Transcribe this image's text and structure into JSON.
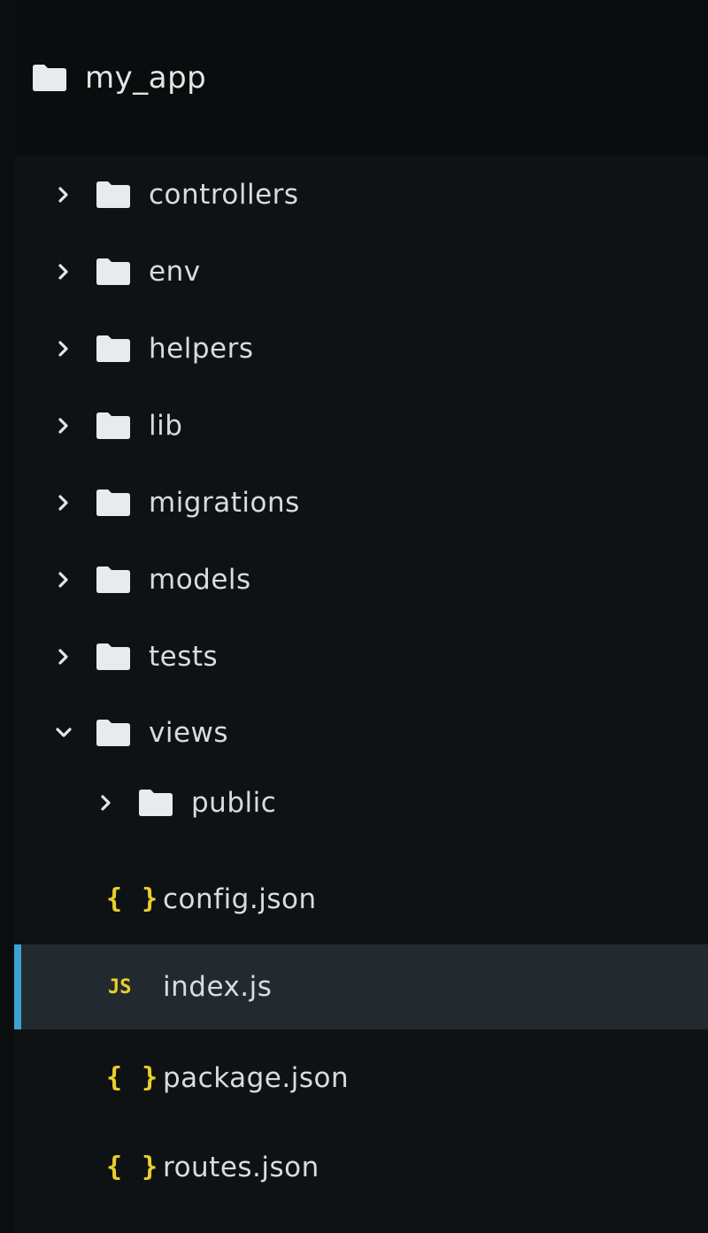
{
  "root": {
    "name": "my_app",
    "icon": "folder-icon"
  },
  "folders": [
    {
      "name": "controllers",
      "expanded": false,
      "icon": "folder-icon"
    },
    {
      "name": "env",
      "expanded": false,
      "icon": "folder-icon"
    },
    {
      "name": "helpers",
      "expanded": false,
      "icon": "folder-icon"
    },
    {
      "name": "lib",
      "expanded": false,
      "icon": "folder-icon"
    },
    {
      "name": "migrations",
      "expanded": false,
      "icon": "folder-icon"
    },
    {
      "name": "models",
      "expanded": false,
      "icon": "folder-icon"
    },
    {
      "name": "tests",
      "expanded": false,
      "icon": "folder-icon"
    },
    {
      "name": "views",
      "expanded": true,
      "icon": "folder-icon"
    }
  ],
  "subfolders": [
    {
      "name": "public",
      "expanded": false,
      "icon": "folder-icon"
    }
  ],
  "files": [
    {
      "name": "config.json",
      "icon_text": "{ }",
      "selected": false
    },
    {
      "name": "index.js",
      "icon_text": "JS",
      "selected": true
    },
    {
      "name": "package.json",
      "icon_text": "{ }",
      "selected": false
    },
    {
      "name": "routes.json",
      "icon_text": "{ }",
      "selected": false
    }
  ],
  "colors": {
    "background": "#0f1214",
    "header": "#0a0c0d",
    "text": "#d9dcdd",
    "file_icon": "#e9cf2a",
    "selection_bg": "#232a2f",
    "selection_accent": "#3ba4d4"
  }
}
